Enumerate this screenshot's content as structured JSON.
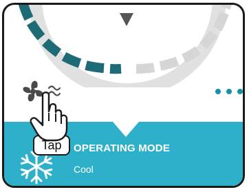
{
  "dial": {
    "arrow_icon": "triangle-down-icon",
    "active_color": "#1d6b77",
    "inactive_color": "#d6d6d6",
    "ring_color": "#e1e1e1"
  },
  "fan": {
    "icon": "fan-icon",
    "swing_icon": "wave-icon"
  },
  "more_menu": {
    "icon": "more-dots-icon",
    "color": "#1592a8"
  },
  "mode_panel": {
    "title": "OPERATING MODE",
    "value": "Cool",
    "icon": "snowflake-icon",
    "background": "#2eb0cb"
  },
  "tutorial": {
    "tap_label": "Tap",
    "pointer_icon": "hand-pointer-icon"
  }
}
